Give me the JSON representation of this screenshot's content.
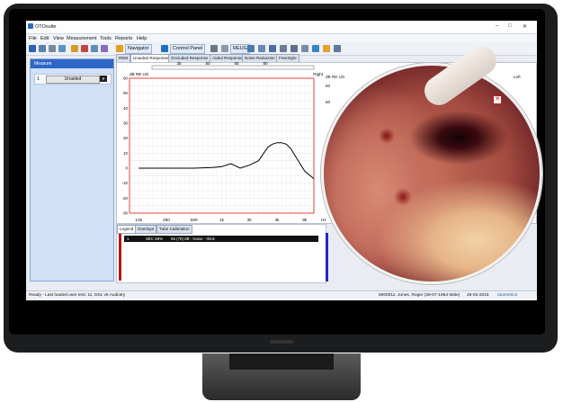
{
  "app": {
    "title": "OTOsuite",
    "window_controls": [
      "–",
      "□",
      "✕"
    ]
  },
  "menu": [
    "File",
    "Edit",
    "View",
    "Measurement",
    "Tools",
    "Reports",
    "Help"
  ],
  "toolbar": {
    "navigator_label": "Navigator",
    "control_panel_label": "Control Panel",
    "reug_label": "REUG"
  },
  "sidebar": {
    "heading": "Measure",
    "row": {
      "index": "1",
      "value": "Unaided",
      "dropdown": "▼"
    }
  },
  "tabs": [
    "REM",
    "Unaided Response",
    "Occluded Response",
    "Aided Response",
    "Noise Reduction",
    "FreeStyle"
  ],
  "right_chart": {
    "ylabel": "dB RE UG",
    "side": "Left",
    "y_ticks": [
      "60",
      "50"
    ],
    "x_tick": "Hz"
  },
  "chart_data": {
    "type": "line",
    "title": "",
    "side": "Right",
    "ylabel": "dB RE UG",
    "xlabel": "Hz",
    "x_categories": [
      "125",
      "250",
      "500",
      "1k",
      "2k",
      "4k",
      "8k"
    ],
    "y_ticks": [
      "60",
      "50",
      "40",
      "30",
      "20",
      "10",
      "0",
      "-10",
      "-20",
      "-30"
    ],
    "ylim": [
      -30,
      60
    ],
    "top_scale": [
      "35",
      "50",
      "65",
      "80"
    ],
    "series": [
      {
        "x_log": [
          2.1,
          2.4,
          2.7,
          2.9,
          3.0,
          3.1,
          3.2,
          3.3,
          3.4,
          3.5,
          3.55,
          3.6,
          3.65,
          3.7,
          3.75,
          3.8,
          3.85,
          3.9,
          4.0
        ],
        "y": [
          0,
          0,
          0,
          0.5,
          1,
          3,
          0,
          2,
          5,
          14,
          16,
          17,
          17,
          16,
          13,
          8,
          3,
          -2,
          -7
        ]
      }
    ],
    "color": "#000000",
    "frame_color": "#e0453a"
  },
  "legend": {
    "tabs": [
      "Legend",
      "Overlays",
      "Tube Calibration"
    ],
    "row_index": "1",
    "row_text1": "SEC 86%",
    "row_text2": "65 (70) dB - Noise - think"
  },
  "status": {
    "left": "Ready - Last loaded user test: 11, DSL v5 Audiotry",
    "patient": "8000011: Jones, Roger (28-07-1954 Male)",
    "date": "25-02-2015",
    "brand": "otometrics"
  },
  "overlay": {
    "close": "✕"
  }
}
